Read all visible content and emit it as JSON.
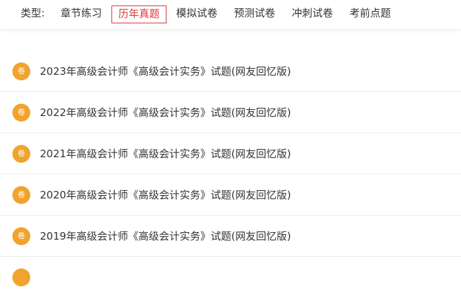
{
  "filter": {
    "label": "类型:",
    "tabs": [
      {
        "label": "章节练习"
      },
      {
        "label": "历年真题"
      },
      {
        "label": "模拟试卷"
      },
      {
        "label": "预测试卷"
      },
      {
        "label": "冲刺试卷"
      },
      {
        "label": "考前点题"
      }
    ],
    "active_tab": "历年真题"
  },
  "papers": {
    "icon_text": "卷",
    "items": [
      {
        "title": "2023年高级会计师《高级会计实务》试题(网友回忆版)"
      },
      {
        "title": "2022年高级会计师《高级会计实务》试题(网友回忆版)"
      },
      {
        "title": "2021年高级会计师《高级会计实务》试题(网友回忆版)"
      },
      {
        "title": "2020年高级会计师《高级会计实务》试题(网友回忆版)"
      },
      {
        "title": "2019年高级会计师《高级会计实务》试题(网友回忆版)"
      }
    ]
  },
  "colors": {
    "accent": "#e0393e",
    "icon_bg": "#f0a32d",
    "text": "#333333",
    "divider": "#ececec"
  }
}
